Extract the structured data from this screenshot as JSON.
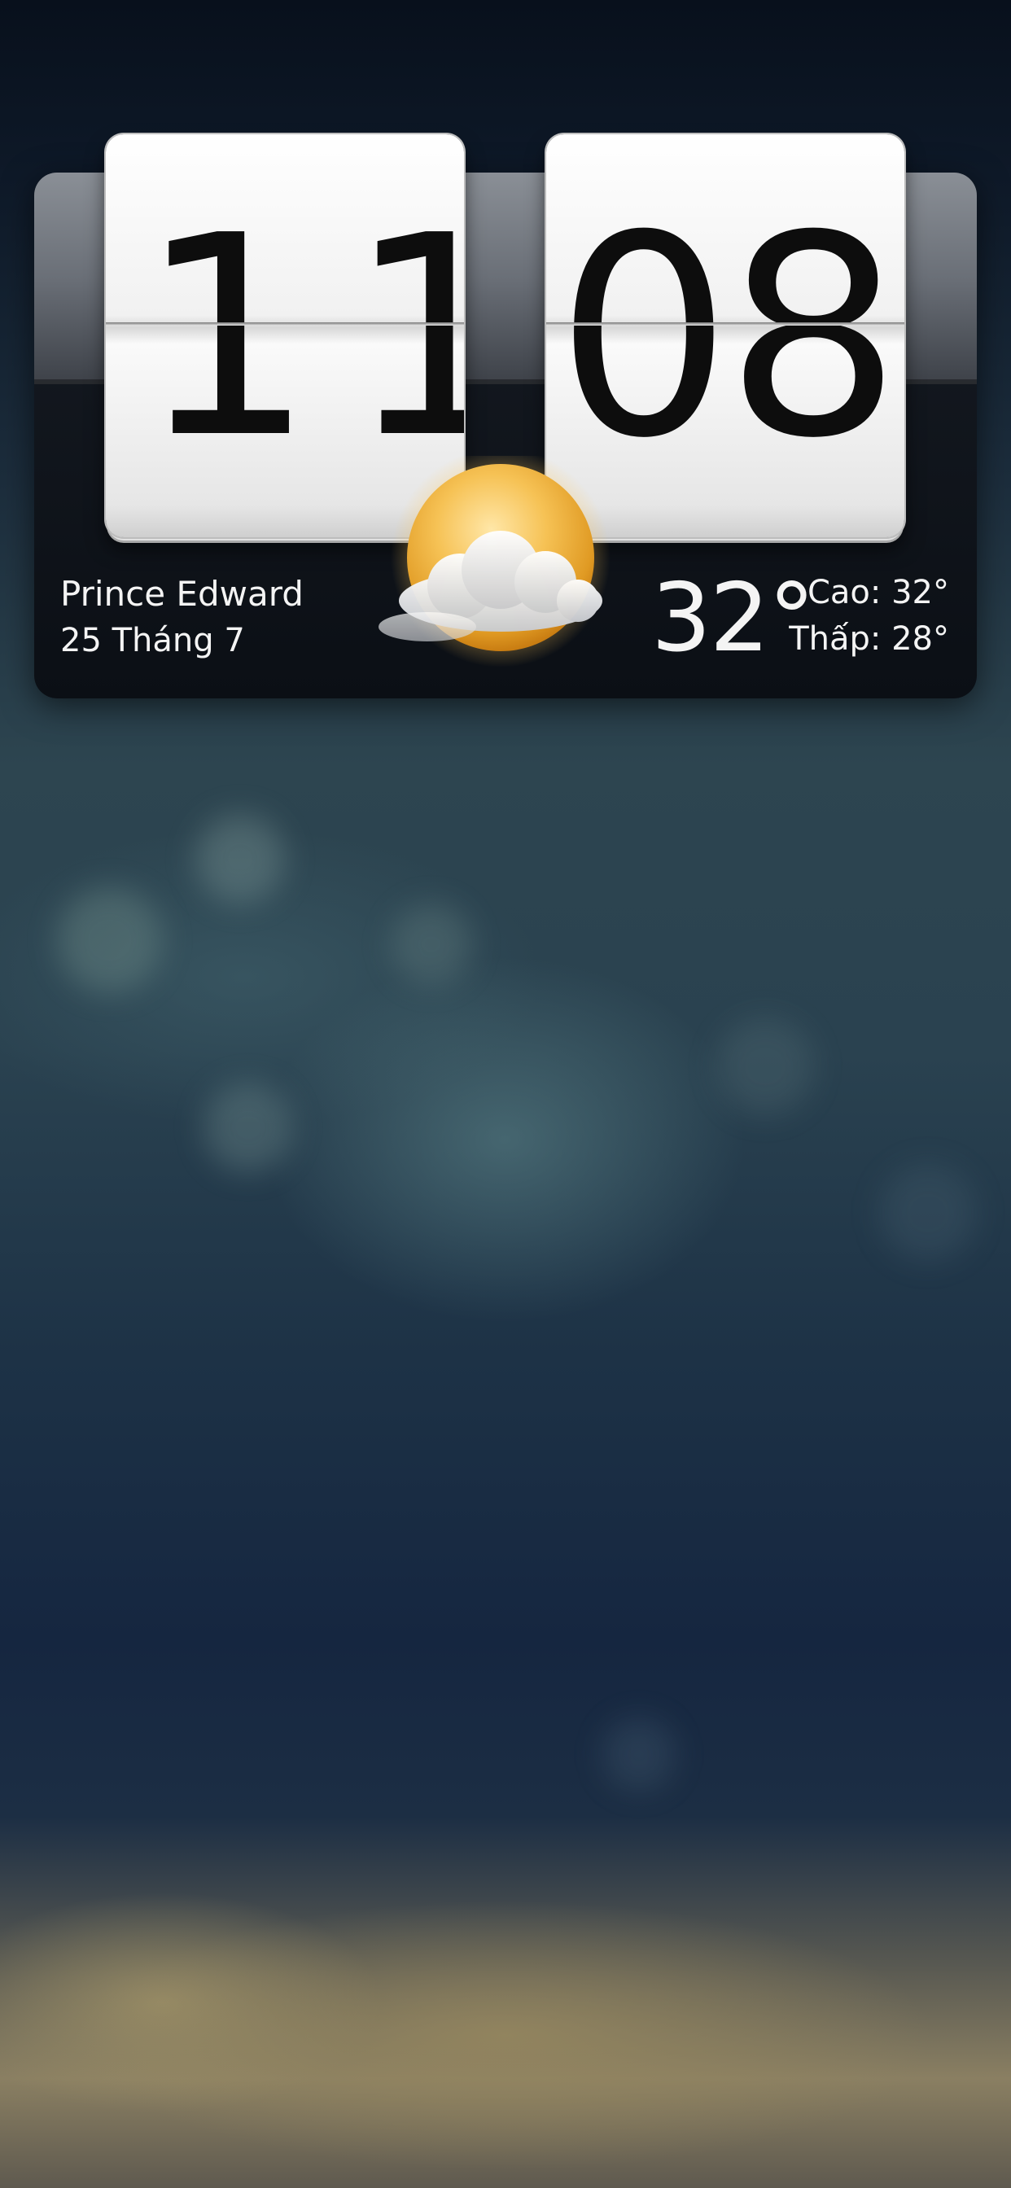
{
  "clock": {
    "hours": "11",
    "minutes": "08"
  },
  "weather": {
    "location": "Prince Edward",
    "date": "25 Tháng 7",
    "temperature": "32°",
    "high": "Cao: 32°",
    "low": "Thấp: 28°",
    "condition_icon": "partly-cloudy-sun-icon"
  },
  "colors": {
    "widget_bg": "#0b0f15",
    "text": "#f4f4f4",
    "sun": "#f0b040"
  }
}
